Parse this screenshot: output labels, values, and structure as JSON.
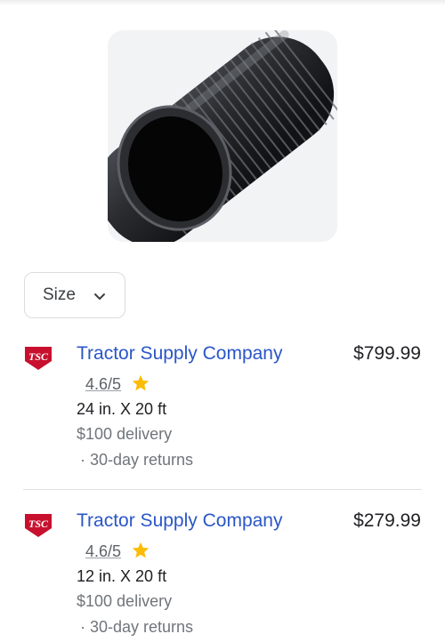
{
  "filters": {
    "size_label": "Size"
  },
  "offers": [
    {
      "merchant": "Tractor Supply Company",
      "logo_text": "TSC",
      "price": "$799.99",
      "rating": "4.6/5",
      "spec": "24 in. X 20 ft",
      "delivery": "$100 delivery",
      "returns": "· 30-day returns"
    },
    {
      "merchant": "Tractor Supply Company",
      "logo_text": "TSC",
      "price": "$279.99",
      "rating": "4.6/5",
      "spec": "12 in. X 20 ft",
      "delivery": "$100 delivery",
      "returns": "· 30-day returns"
    }
  ],
  "colors": {
    "link": "#2a56c6",
    "star": "#fbbc04",
    "logo_red": "#c8102e"
  },
  "icons": {
    "rating": "star-icon",
    "dropdown": "chevron-down-icon",
    "merchant": "tsc-logo-icon"
  }
}
